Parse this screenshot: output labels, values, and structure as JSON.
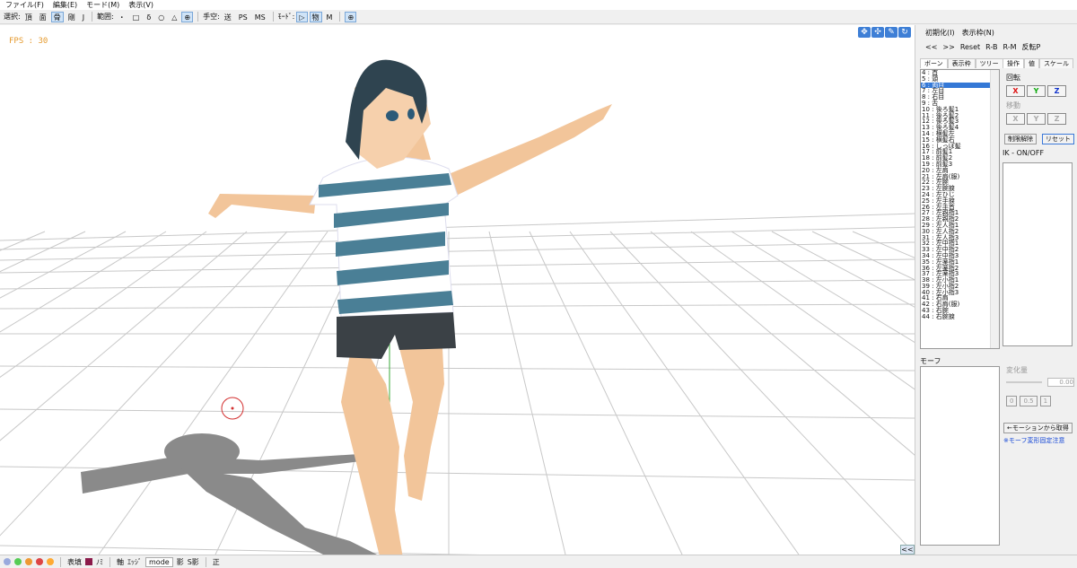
{
  "menu": [
    "ファイル(F)",
    "編集(E)",
    "モード(M)",
    "表示(V)"
  ],
  "toolbar": {
    "select_label": "選択:",
    "select_items": [
      "頂",
      "面",
      "骨",
      "剛",
      "J"
    ],
    "range_label": "範囲:",
    "range_items": [
      "・",
      "□",
      "δ",
      "○",
      "△",
      "⊕"
    ],
    "handle_label": "手空:",
    "handle_items": [
      "送",
      "PS",
      "MS"
    ],
    "mode_label": "ﾓｰﾄﾞ:",
    "mode_items": [
      "▷",
      "物",
      "M"
    ]
  },
  "viewport": {
    "fps_label": "FPS : 30",
    "collapse": "<<"
  },
  "right": {
    "menu": [
      "初期化(I)",
      "表示枠(N)"
    ],
    "nav": [
      "<<",
      ">>",
      "Reset",
      "R-B",
      "R-M",
      "反転P"
    ],
    "bone_tabs": [
      "ボーン",
      "表示枠",
      "ツリー"
    ],
    "op_tabs": [
      "操作",
      "値",
      "スケール"
    ],
    "rotate_label": "回転",
    "move_label": "移動",
    "axes": [
      "X",
      "Y",
      "Z"
    ],
    "partial_release": "制限解除",
    "reset": "リセット",
    "ik_label": "IK - ON/OFF",
    "morph_label": "モーフ",
    "morph_amount_label": "変化量",
    "morph_value": "0.00",
    "morph_presets": [
      "0",
      "0.5",
      "1"
    ],
    "get_from_motion": "←モーションから取得",
    "note": "※モーフ変形固定注意",
    "bones": [
      "4 : 首",
      "5 : 頭",
      "6 : 両目",
      "7 : 左目",
      "8 : 右目",
      "9 : 舌",
      "10 : 後ろ髪1",
      "11 : 後ろ髪2",
      "12 : 後ろ髪3",
      "13 : 後ろ髪4",
      "14 : 横髪左",
      "15 : 横髪右",
      "16 : しっぽ髪",
      "17 : 前髪1",
      "18 : 前髪2",
      "19 : 前髪3",
      "20 : 左肩",
      "21 : 左肩(服)",
      "22 : 左腕",
      "23 : 左腕捩",
      "24 : 左ひじ",
      "25 : 左手捩",
      "26 : 左手首",
      "27 : 左親指1",
      "28 : 左親指2",
      "29 : 左人指1",
      "30 : 左人指2",
      "31 : 左人指3",
      "32 : 左中指1",
      "33 : 左中指2",
      "34 : 左中指3",
      "35 : 左薬指1",
      "36 : 左薬指2",
      "37 : 左薬指3",
      "38 : 左小指1",
      "39 : 左小指2",
      "40 : 左小指3",
      "41 : 右肩",
      "42 : 右肩(服)",
      "43 : 右腕",
      "44 : 右腕捩"
    ],
    "selected_bone_index": 2
  },
  "status": {
    "labels": [
      "表填",
      "ﾉﾐ",
      "軸",
      "ｴｯｼﾞ",
      "mode",
      "影",
      "S影",
      "正"
    ]
  }
}
